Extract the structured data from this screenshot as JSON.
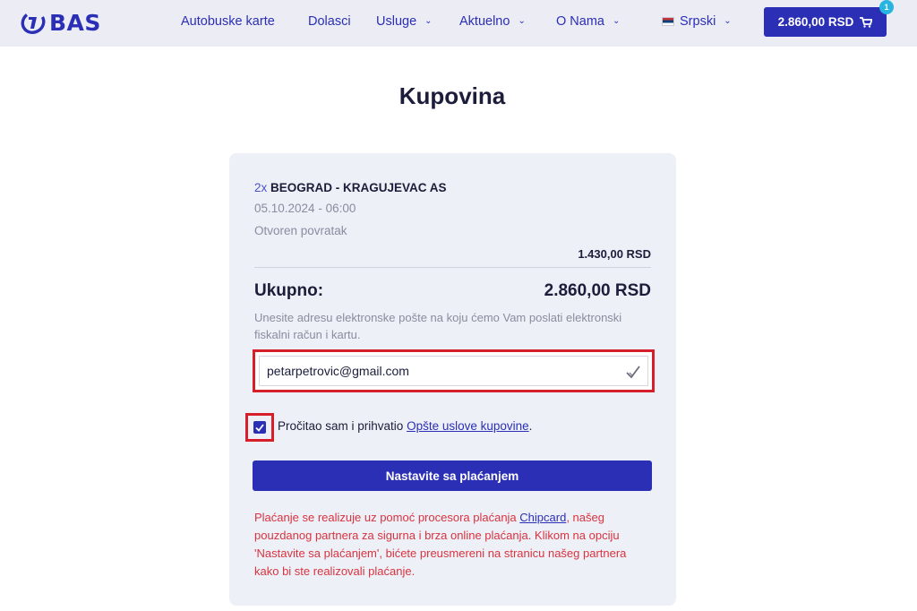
{
  "header": {
    "logo_text": "BAS",
    "nav": {
      "autobuske_karte": "Autobuske karte",
      "dolasci": "Dolasci",
      "usluge": "Usluge",
      "aktuelno": "Aktuelno",
      "o_nama": "O Nama"
    },
    "language": "Srpski",
    "cart_total": "2.860,00 RSD",
    "cart_count": "1"
  },
  "page": {
    "title": "Kupovina"
  },
  "order": {
    "quantity": "2x",
    "route": "BEOGRAD - KRAGUJEVAC AS",
    "datetime": "05.10.2024 - 06:00",
    "return_type": "Otvoren povratak",
    "line_price": "1.430,00 RSD",
    "total_label": "Ukupno:",
    "total_value": "2.860,00 RSD"
  },
  "email": {
    "note": "Unesite adresu elektronske pošte na koju ćemo Vam poslati elektronski fiskalni račun i kartu.",
    "value": "petarpetrovic@gmail.com",
    "placeholder": ""
  },
  "terms": {
    "checked": true,
    "text": "Pročitao sam i prihvatio ",
    "link": "Opšte uslove kupovine",
    "suffix": "."
  },
  "pay_button": "Nastavite sa plaćanjem",
  "payment_info": {
    "part1": "Plaćanje se realizuje uz pomoć procesora plaćanja ",
    "link": "Chipcard",
    "part2": ", našeg pouzdanog partnera za sigurna i brza online plaćanja. Klikom na opciju 'Nastavite sa plaćanjem', bićete preusmereni na stranicu našeg partnera kako bi ste realizovali plaćanje."
  },
  "colors": {
    "brand": "#2b2fb5",
    "header_bg": "#ececf4",
    "card_bg": "#eef0f7",
    "highlight": "#d71f2b",
    "info_text": "#d9333f",
    "badge": "#28b4e0"
  },
  "icons": [
    "bas-logo-icon",
    "chevron-down-icon",
    "serbia-flag-icon",
    "cart-icon",
    "checkmark-icon",
    "checkbox-checked-icon"
  ]
}
